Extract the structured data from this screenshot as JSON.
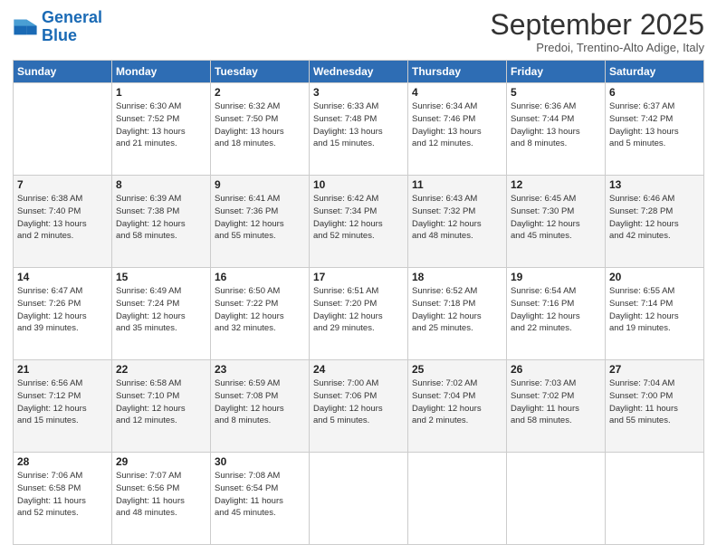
{
  "header": {
    "logo_line1": "General",
    "logo_line2": "Blue",
    "month": "September 2025",
    "location": "Predoi, Trentino-Alto Adige, Italy"
  },
  "days_of_week": [
    "Sunday",
    "Monday",
    "Tuesday",
    "Wednesday",
    "Thursday",
    "Friday",
    "Saturday"
  ],
  "weeks": [
    [
      {
        "day": "",
        "info": ""
      },
      {
        "day": "1",
        "info": "Sunrise: 6:30 AM\nSunset: 7:52 PM\nDaylight: 13 hours\nand 21 minutes."
      },
      {
        "day": "2",
        "info": "Sunrise: 6:32 AM\nSunset: 7:50 PM\nDaylight: 13 hours\nand 18 minutes."
      },
      {
        "day": "3",
        "info": "Sunrise: 6:33 AM\nSunset: 7:48 PM\nDaylight: 13 hours\nand 15 minutes."
      },
      {
        "day": "4",
        "info": "Sunrise: 6:34 AM\nSunset: 7:46 PM\nDaylight: 13 hours\nand 12 minutes."
      },
      {
        "day": "5",
        "info": "Sunrise: 6:36 AM\nSunset: 7:44 PM\nDaylight: 13 hours\nand 8 minutes."
      },
      {
        "day": "6",
        "info": "Sunrise: 6:37 AM\nSunset: 7:42 PM\nDaylight: 13 hours\nand 5 minutes."
      }
    ],
    [
      {
        "day": "7",
        "info": "Sunrise: 6:38 AM\nSunset: 7:40 PM\nDaylight: 13 hours\nand 2 minutes."
      },
      {
        "day": "8",
        "info": "Sunrise: 6:39 AM\nSunset: 7:38 PM\nDaylight: 12 hours\nand 58 minutes."
      },
      {
        "day": "9",
        "info": "Sunrise: 6:41 AM\nSunset: 7:36 PM\nDaylight: 12 hours\nand 55 minutes."
      },
      {
        "day": "10",
        "info": "Sunrise: 6:42 AM\nSunset: 7:34 PM\nDaylight: 12 hours\nand 52 minutes."
      },
      {
        "day": "11",
        "info": "Sunrise: 6:43 AM\nSunset: 7:32 PM\nDaylight: 12 hours\nand 48 minutes."
      },
      {
        "day": "12",
        "info": "Sunrise: 6:45 AM\nSunset: 7:30 PM\nDaylight: 12 hours\nand 45 minutes."
      },
      {
        "day": "13",
        "info": "Sunrise: 6:46 AM\nSunset: 7:28 PM\nDaylight: 12 hours\nand 42 minutes."
      }
    ],
    [
      {
        "day": "14",
        "info": "Sunrise: 6:47 AM\nSunset: 7:26 PM\nDaylight: 12 hours\nand 39 minutes."
      },
      {
        "day": "15",
        "info": "Sunrise: 6:49 AM\nSunset: 7:24 PM\nDaylight: 12 hours\nand 35 minutes."
      },
      {
        "day": "16",
        "info": "Sunrise: 6:50 AM\nSunset: 7:22 PM\nDaylight: 12 hours\nand 32 minutes."
      },
      {
        "day": "17",
        "info": "Sunrise: 6:51 AM\nSunset: 7:20 PM\nDaylight: 12 hours\nand 29 minutes."
      },
      {
        "day": "18",
        "info": "Sunrise: 6:52 AM\nSunset: 7:18 PM\nDaylight: 12 hours\nand 25 minutes."
      },
      {
        "day": "19",
        "info": "Sunrise: 6:54 AM\nSunset: 7:16 PM\nDaylight: 12 hours\nand 22 minutes."
      },
      {
        "day": "20",
        "info": "Sunrise: 6:55 AM\nSunset: 7:14 PM\nDaylight: 12 hours\nand 19 minutes."
      }
    ],
    [
      {
        "day": "21",
        "info": "Sunrise: 6:56 AM\nSunset: 7:12 PM\nDaylight: 12 hours\nand 15 minutes."
      },
      {
        "day": "22",
        "info": "Sunrise: 6:58 AM\nSunset: 7:10 PM\nDaylight: 12 hours\nand 12 minutes."
      },
      {
        "day": "23",
        "info": "Sunrise: 6:59 AM\nSunset: 7:08 PM\nDaylight: 12 hours\nand 8 minutes."
      },
      {
        "day": "24",
        "info": "Sunrise: 7:00 AM\nSunset: 7:06 PM\nDaylight: 12 hours\nand 5 minutes."
      },
      {
        "day": "25",
        "info": "Sunrise: 7:02 AM\nSunset: 7:04 PM\nDaylight: 12 hours\nand 2 minutes."
      },
      {
        "day": "26",
        "info": "Sunrise: 7:03 AM\nSunset: 7:02 PM\nDaylight: 11 hours\nand 58 minutes."
      },
      {
        "day": "27",
        "info": "Sunrise: 7:04 AM\nSunset: 7:00 PM\nDaylight: 11 hours\nand 55 minutes."
      }
    ],
    [
      {
        "day": "28",
        "info": "Sunrise: 7:06 AM\nSunset: 6:58 PM\nDaylight: 11 hours\nand 52 minutes."
      },
      {
        "day": "29",
        "info": "Sunrise: 7:07 AM\nSunset: 6:56 PM\nDaylight: 11 hours\nand 48 minutes."
      },
      {
        "day": "30",
        "info": "Sunrise: 7:08 AM\nSunset: 6:54 PM\nDaylight: 11 hours\nand 45 minutes."
      },
      {
        "day": "",
        "info": ""
      },
      {
        "day": "",
        "info": ""
      },
      {
        "day": "",
        "info": ""
      },
      {
        "day": "",
        "info": ""
      }
    ]
  ]
}
